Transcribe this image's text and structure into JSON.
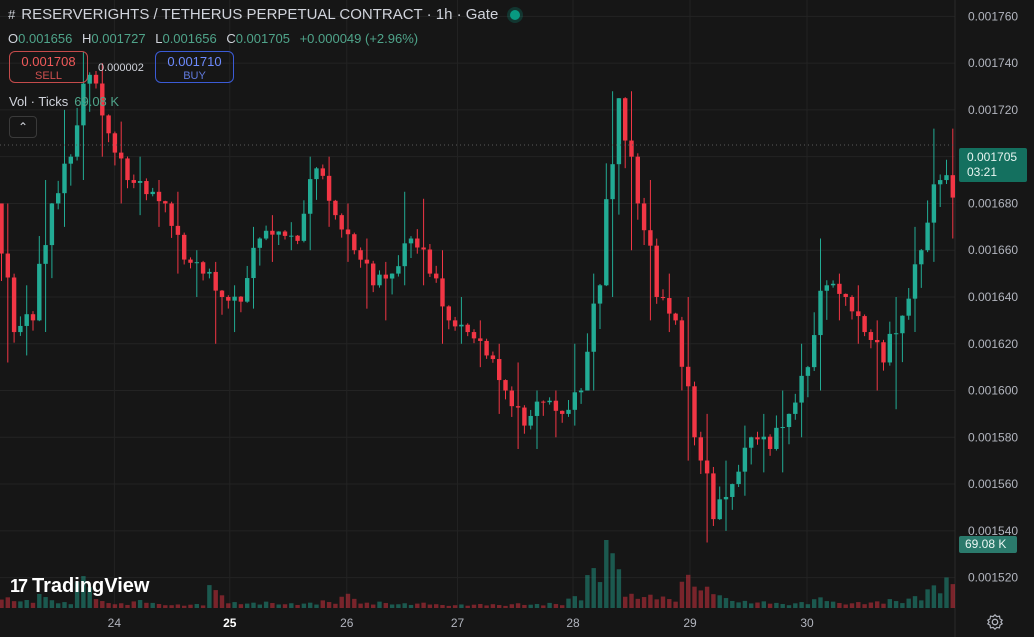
{
  "header": {
    "title": "RESERVERIGHTS / TETHERUS PERPETUAL CONTRACT · 1h · Gate",
    "open_key": "O",
    "open": "0.001656",
    "high_key": "H",
    "high": "0.001727",
    "low_key": "L",
    "low": "0.001656",
    "close_key": "C",
    "close": "0.001705",
    "change": "+0.000049 (+2.96%)"
  },
  "trade": {
    "sell_price": "0.001708",
    "sell_label": "SELL",
    "spread": "0.000002",
    "buy_price": "0.001710",
    "buy_label": "BUY"
  },
  "volume_legend": {
    "label": "Vol · Ticks",
    "value": "69.08 K"
  },
  "price_tag": {
    "price": "0.001705",
    "countdown": "03:21"
  },
  "volume_tag": "69.08 K",
  "branding": "TradingView",
  "colors": {
    "up": "#22ab94",
    "down": "#f23645",
    "background": "#161616",
    "grid": "#232323"
  },
  "chart_data": {
    "type": "candlestick",
    "timeframe": "1h",
    "y_axis_ticks": [
      "0.001760",
      "0.001740",
      "0.001720",
      "0.001700",
      "0.001680",
      "0.001660",
      "0.001640",
      "0.001620",
      "0.001600",
      "0.001580",
      "0.001560",
      "0.001540",
      "0.001520"
    ],
    "x_axis_ticks": [
      "24",
      "25",
      "26",
      "27",
      "28",
      "29",
      "30"
    ],
    "ylim": [
      0.001507,
      0.001767
    ],
    "x_day_positions": [
      2.8,
      6.5,
      10.25,
      13.8,
      17.5,
      21.25,
      25
    ],
    "grid": true,
    "anchors": [
      [
        0.00168,
        0.00168,
        0.001612,
        0.001625
      ],
      [
        0.001625,
        0.001645,
        0.001615,
        0.00163
      ],
      [
        0.00163,
        0.00169,
        0.001625,
        0.00168
      ],
      [
        0.00168,
        0.00172,
        0.00167,
        0.0017
      ],
      [
        0.0017,
        0.001745,
        0.00169,
        0.001735
      ],
      [
        0.001735,
        0.00174,
        0.0017,
        0.00171
      ],
      [
        0.00171,
        0.001715,
        0.00168,
        0.00169
      ],
      [
        0.00169,
        0.0017,
        0.001675,
        0.001684
      ],
      [
        0.001684,
        0.00169,
        0.00167,
        0.00168
      ],
      [
        0.00168,
        0.001685,
        0.00165,
        0.001656
      ],
      [
        0.001656,
        0.00166,
        0.00164,
        0.00165
      ],
      [
        0.00165,
        0.001655,
        0.00162,
        0.00164
      ],
      [
        0.00164,
        0.001645,
        0.001625,
        0.001638
      ],
      [
        0.001638,
        0.00167,
        0.001635,
        0.001665
      ],
      [
        0.001665,
        0.001675,
        0.001655,
        0.001668
      ],
      [
        0.001668,
        0.001672,
        0.00166,
        0.001664
      ],
      [
        0.001664,
        0.0017,
        0.00166,
        0.001695
      ],
      [
        0.001695,
        0.0017,
        0.00167,
        0.001675
      ],
      [
        0.001675,
        0.00168,
        0.001655,
        0.00166
      ],
      [
        0.00166,
        0.001665,
        0.001635,
        0.001645
      ],
      [
        0.001645,
        0.001655,
        0.00163,
        0.00165
      ],
      [
        0.00165,
        0.001685,
        0.001645,
        0.001665
      ],
      [
        0.001665,
        0.001682,
        0.001645,
        0.00165
      ],
      [
        0.00165,
        0.00166,
        0.00162,
        0.00163
      ],
      [
        0.00163,
        0.00164,
        0.00162,
        0.001625
      ],
      [
        0.001625,
        0.00163,
        0.00161,
        0.001615
      ],
      [
        0.001615,
        0.00162,
        0.00159,
        0.0016
      ],
      [
        0.0016,
        0.001612,
        0.001575,
        0.001585
      ],
      [
        0.001585,
        0.0016,
        0.001575,
        0.001595
      ],
      [
        0.001595,
        0.0016,
        0.00158,
        0.00159
      ],
      [
        0.00159,
        0.00162,
        0.001585,
        0.0016
      ],
      [
        0.0016,
        0.00165,
        0.0016,
        0.001645
      ],
      [
        0.001645,
        0.001728,
        0.00164,
        0.001725
      ],
      [
        0.001725,
        0.001728,
        0.00166,
        0.00168
      ],
      [
        0.00168,
        0.00169,
        0.00163,
        0.00164
      ],
      [
        0.00164,
        0.00165,
        0.001625,
        0.00163
      ],
      [
        0.00163,
        0.00164,
        0.00157,
        0.00158
      ],
      [
        0.00158,
        0.00159,
        0.001535,
        0.001545
      ],
      [
        0.001545,
        0.00157,
        0.00154,
        0.00156
      ],
      [
        0.00156,
        0.001585,
        0.001555,
        0.00158
      ],
      [
        0.00158,
        0.00159,
        0.001565,
        0.001575
      ],
      [
        0.001575,
        0.0016,
        0.001565,
        0.00159
      ],
      [
        0.00159,
        0.00162,
        0.00158,
        0.00161
      ],
      [
        0.00161,
        0.001665,
        0.0016,
        0.001645
      ],
      [
        0.001645,
        0.00165,
        0.00163,
        0.00164
      ],
      [
        0.00164,
        0.001645,
        0.00162,
        0.001625
      ],
      [
        0.001625,
        0.00163,
        0.0016,
        0.001612
      ],
      [
        0.001612,
        0.00164,
        0.001592,
        0.001632
      ],
      [
        0.001632,
        0.00167,
        0.001625,
        0.00166
      ],
      [
        0.00166,
        0.001712,
        0.001655,
        0.00169
      ],
      [
        0.00169,
        0.001712,
        0.001665,
        0.00168
      ],
      [
        0.00168,
        0.00171,
        0.00166,
        0.00167
      ],
      [
        0.00167,
        0.001692,
        0.00166,
        0.00169
      ],
      [
        0.00169,
        0.001727,
        0.001656,
        0.001705
      ]
    ],
    "anchor_volumes": [
      0.9,
      0.6,
      1.1,
      0.5,
      2.4,
      0.7,
      0.4,
      0.6,
      0.4,
      0.3,
      0.3,
      1.8,
      0.5,
      0.4,
      0.5,
      0.4,
      0.4,
      0.6,
      1.2,
      0.4,
      0.5,
      0.4,
      0.4,
      0.3,
      0.3,
      0.3,
      0.3,
      0.4,
      0.3,
      0.4,
      1.0,
      3.0,
      5.5,
      1.2,
      1.0,
      0.9,
      2.8,
      1.6,
      1.0,
      0.6,
      0.5,
      0.4,
      0.5,
      0.8,
      0.5,
      0.5,
      0.5,
      0.7,
      1.0,
      1.7,
      2.4,
      1.6,
      1.1,
      3.5
    ],
    "volume_ylim": [
      0,
      5.6
    ]
  }
}
